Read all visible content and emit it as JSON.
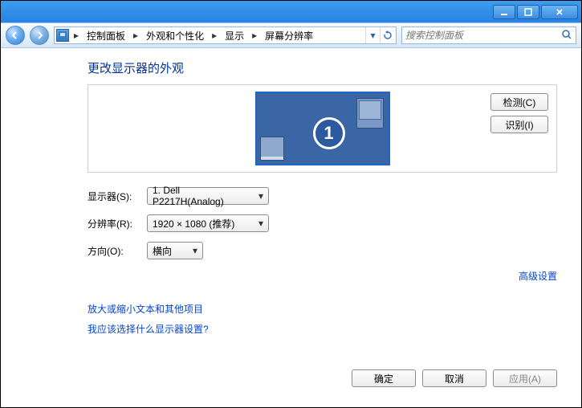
{
  "breadcrumb": {
    "items": [
      "控制面板",
      "外观和个性化",
      "显示",
      "屏幕分辨率"
    ]
  },
  "search": {
    "placeholder": "搜索控制面板"
  },
  "page": {
    "title": "更改显示器的外观",
    "detect_label": "检测(C)",
    "identify_label": "识别(I)",
    "monitor_number": "1"
  },
  "form": {
    "display_label": "显示器(S):",
    "display_value": "1. Dell P2217H(Analog)",
    "resolution_label": "分辨率(R):",
    "resolution_value": "1920 × 1080 (推荐)",
    "orientation_label": "方向(O):",
    "orientation_value": "横向"
  },
  "advanced_link": "高级设置",
  "links": {
    "zoom": "放大或缩小文本和其他项目",
    "help": "我应该选择什么显示器设置?"
  },
  "buttons": {
    "ok": "确定",
    "cancel": "取消",
    "apply": "应用(A)"
  }
}
